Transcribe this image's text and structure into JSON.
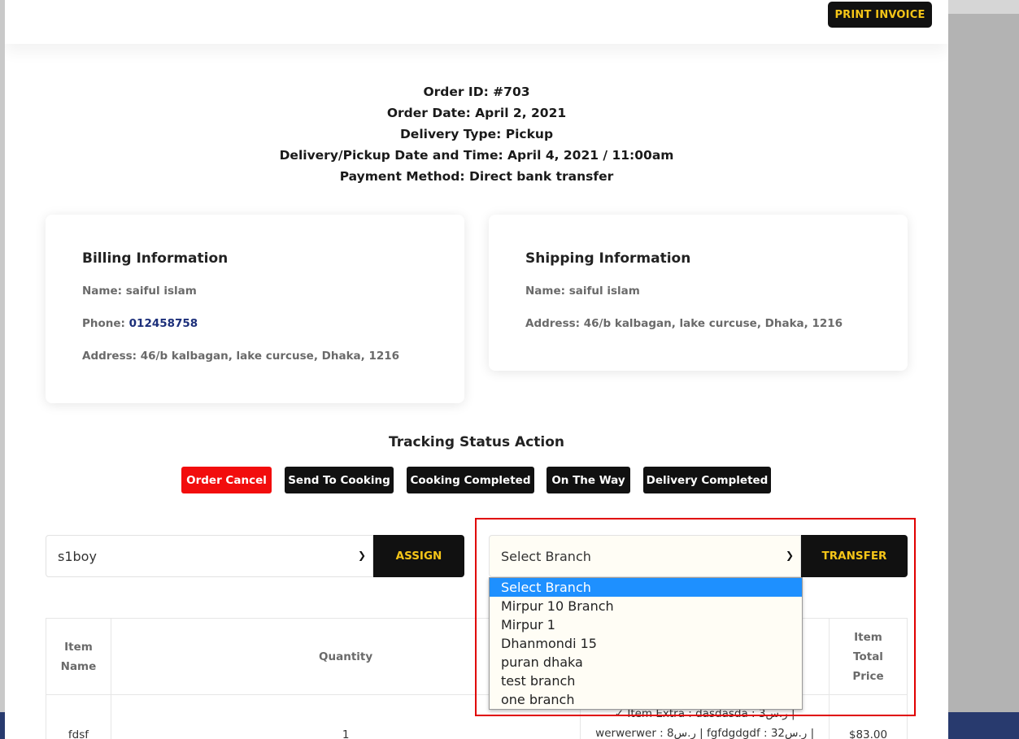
{
  "header": {
    "print_label": "PRINT INVOICE"
  },
  "order": {
    "id_line": "Order ID: #703",
    "date_line": "Order Date: April 2, 2021",
    "type_line": "Delivery Type: Pickup",
    "datetime_line": "Delivery/Pickup Date and Time: April 4, 2021 / 11:00am",
    "payment_line": "Payment Method: Direct bank transfer"
  },
  "billing": {
    "title": "Billing Information",
    "name": "Name: saiful islam",
    "phone_label": "Phone: ",
    "phone_value": "012458758",
    "address": "Address: 46/b kalbagan, lake curcuse, Dhaka, 1216"
  },
  "shipping": {
    "title": "Shipping Information",
    "name": "Name: saiful islam",
    "address": "Address: 46/b kalbagan, lake curcuse, Dhaka, 1216"
  },
  "tracking": {
    "title": "Tracking Status Action",
    "buttons": [
      "Order Cancel",
      "Send To Cooking",
      "Cooking Completed",
      "On The Way",
      "Delivery Completed"
    ]
  },
  "assign": {
    "selected": "s1boy",
    "button": "ASSIGN"
  },
  "transfer": {
    "selected": "Select Branch",
    "button": "TRANSFER",
    "options": [
      "Select Branch",
      "Mirpur 10 Branch",
      "Mirpur 1",
      "Dhanmondi 15",
      "puran dhaka",
      "test branch",
      "one branch"
    ]
  },
  "table": {
    "headers": [
      "Item Name",
      "Quantity",
      "Item Total Price"
    ],
    "row": {
      "name": "fdsf",
      "quantity": "1",
      "extra_line1": "✓ Item Extra : dasdasda : 3ر.س |",
      "extra_line2": "werwerwer : 8ر.س | fgfdgdgdf : 32ر.س |",
      "total": "$83.00"
    }
  },
  "colors": {
    "accent": "#f5c518",
    "danger": "#f20d0d",
    "dark": "#111111",
    "highlight": "#e00000",
    "selected_option": "#1e90ff"
  }
}
